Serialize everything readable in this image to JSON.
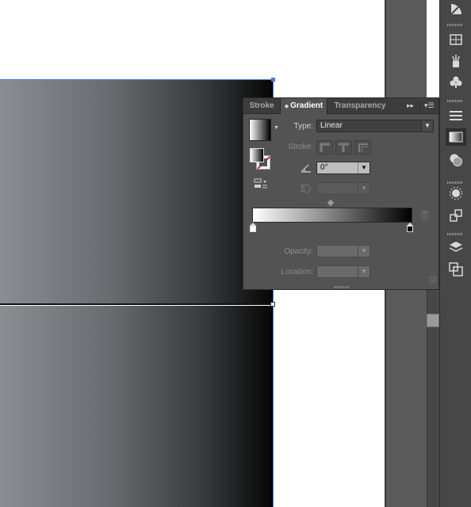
{
  "panel": {
    "tabs": [
      {
        "label": "Stroke",
        "active": false
      },
      {
        "label": "Gradient",
        "active": true
      },
      {
        "label": "Transparency",
        "active": false
      }
    ],
    "collapse_icon": "double-right-arrow-icon",
    "menu_icon": "panel-menu-icon",
    "labels": {
      "type": "Type:",
      "stroke": "Stroke:",
      "opacity": "Opacity:",
      "location": "Location:"
    },
    "type_value": "Linear",
    "angle_value": "0°",
    "aspect_value": "",
    "opacity_value": "",
    "location_value": ""
  },
  "gradient": {
    "start_color": "#ffffff",
    "end_color": "#000000"
  },
  "artwork": {
    "gradient_colors": [
      "#8b8d93",
      "#6a6b70",
      "#38393b",
      "#050505"
    ],
    "selection_color": "#4d78cc"
  },
  "dock_icons": [
    "symbols-icon",
    "swatch-grid-icon",
    "brushes-icon",
    "clubs-symbol-icon",
    "lines-stroke-icon",
    "gradient-icon",
    "transparency-icon",
    "appearance-icon",
    "graphic-styles-icon",
    "layers-icon",
    "artboards-icon"
  ]
}
